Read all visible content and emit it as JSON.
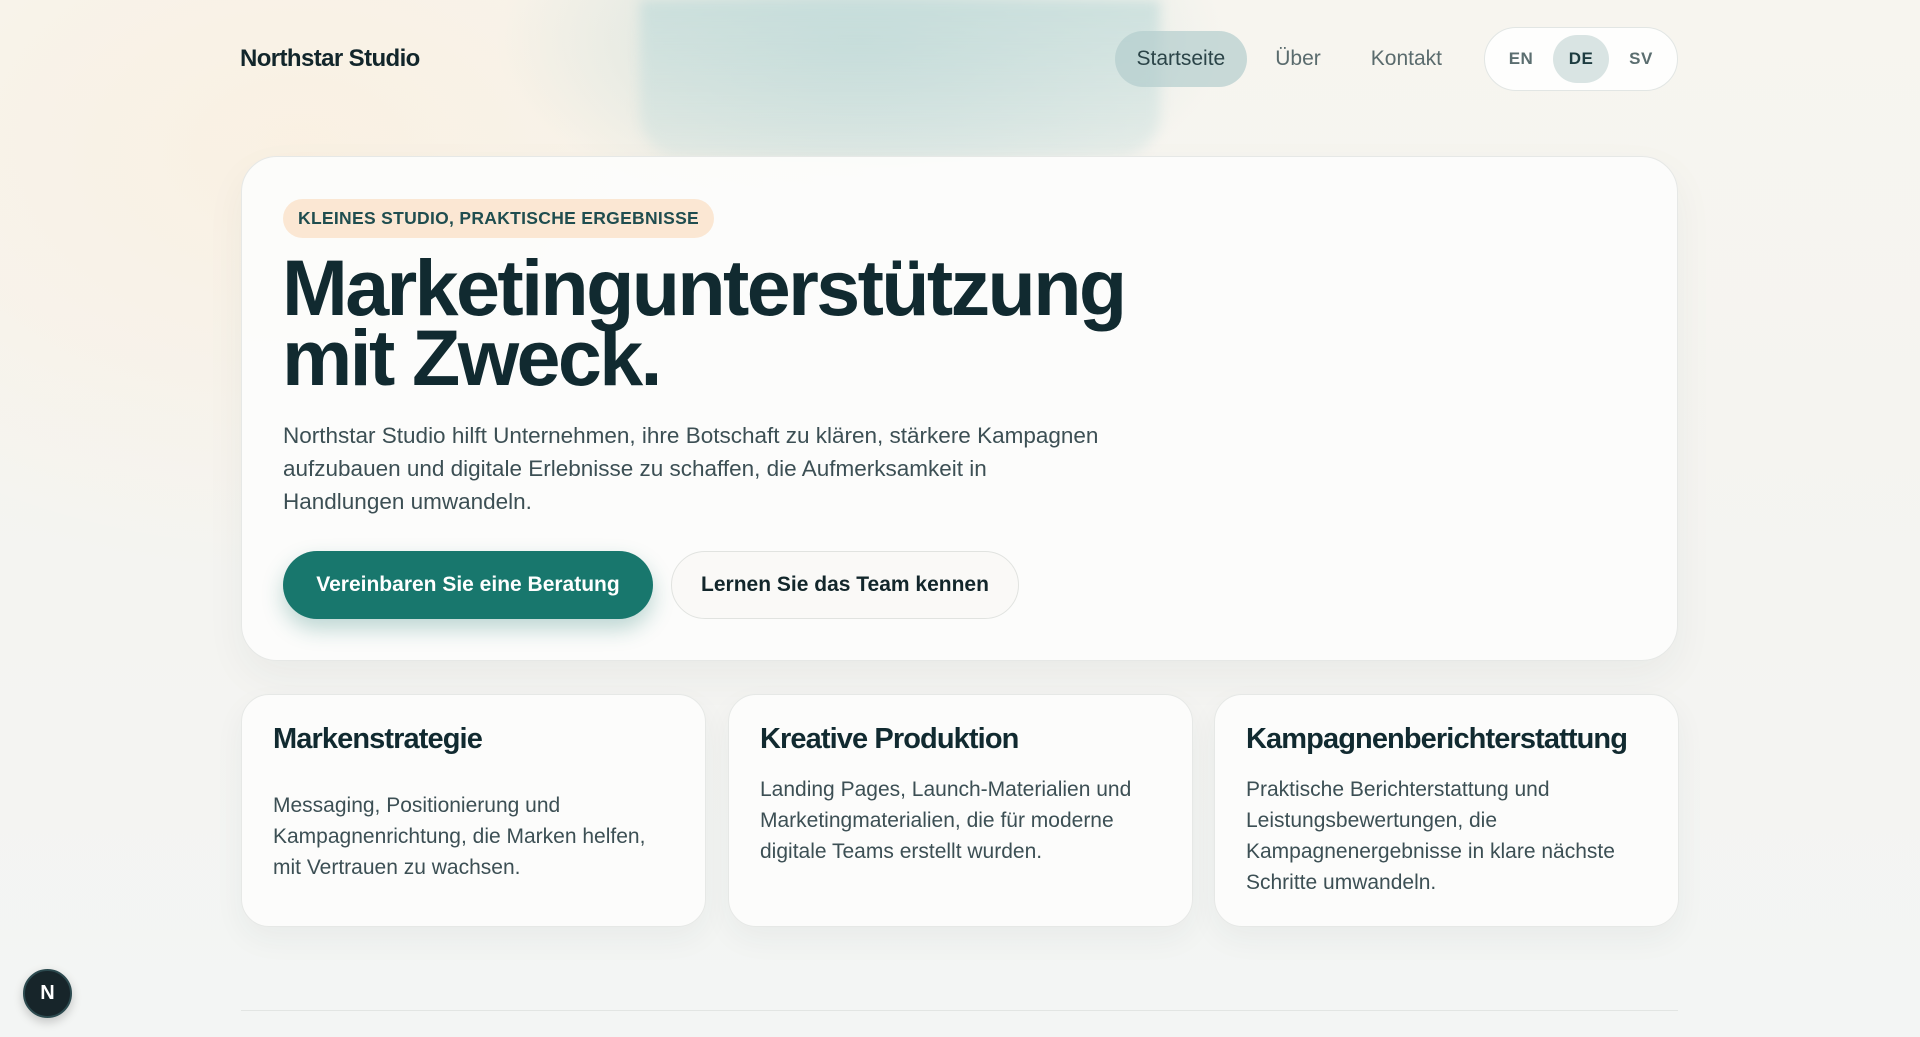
{
  "header": {
    "brand": "Northstar Studio",
    "nav": [
      {
        "label": "Startseite",
        "active": true
      },
      {
        "label": "Über",
        "active": false
      },
      {
        "label": "Kontakt",
        "active": false
      }
    ],
    "languages": [
      {
        "label": "EN",
        "active": false
      },
      {
        "label": "DE",
        "active": true
      },
      {
        "label": "SV",
        "active": false
      }
    ]
  },
  "hero": {
    "badge": "KLEINES STUDIO, PRAKTISCHE ERGEBNISSE",
    "title_line1": "Marketingunterstützung",
    "title_line2": "mit Zweck.",
    "description": "Northstar Studio hilft Unternehmen, ihre Botschaft zu klären, stärkere Kampagnen aufzubauen und digitale Erlebnisse zu schaffen, die Aufmerksamkeit in Handlungen umwandeln.",
    "primary_cta": "Vereinbaren Sie eine Beratung",
    "secondary_cta": "Lernen Sie das Team kennen"
  },
  "services": [
    {
      "title": "Markenstrategie",
      "text": "Messaging, Positionierung und Kampagnenrichtung, die Marken helfen, mit Vertrauen zu wachsen."
    },
    {
      "title": "Kreative Produktion",
      "text": "Landing Pages, Launch-Materialien und Marketingmaterialien, die für moderne digitale Teams erstellt wurden."
    },
    {
      "title": "Kampagnenberichterstattung",
      "text": "Praktische Berichterstattung und Leistungsbewertungen, die Kampagnenergebnisse in klare nächste Schritte umwandeln."
    }
  ],
  "dev_badge": "N",
  "colors": {
    "accent": "#18776d",
    "badge_bg": "#fbe7d3",
    "text_dark": "#112a30"
  }
}
